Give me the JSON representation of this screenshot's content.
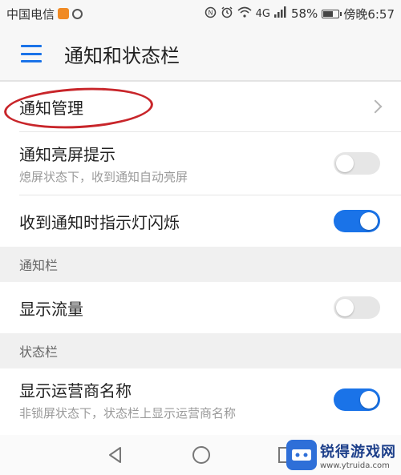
{
  "status_bar": {
    "carrier": "中国电信",
    "signal_label": "4G",
    "battery_percent": "58%",
    "time": "傍晚6:57",
    "icons": [
      "app-notification-icon",
      "circle-app-icon",
      "nfc-icon",
      "alarm-icon",
      "wifi-icon",
      "signal-icon",
      "battery-icon"
    ]
  },
  "app_bar": {
    "title": "通知和状态栏",
    "menu_icon": "menu-icon"
  },
  "settings": {
    "notification_management": {
      "title": "通知管理"
    },
    "notification_wake_screen": {
      "title": "通知亮屏提示",
      "subtitle": "熄屏状态下，收到通知自动亮屏",
      "enabled": false
    },
    "indicator_light": {
      "title": "收到通知时指示灯闪烁",
      "enabled": true
    },
    "section_notification_bar": "通知栏",
    "show_traffic": {
      "title": "显示流量",
      "enabled": false
    },
    "section_status_bar": "状态栏",
    "show_carrier_name": {
      "title": "显示运营商名称",
      "subtitle": "非锁屏状态下，状态栏上显示运营商名称",
      "enabled": true
    }
  },
  "nav_bar": {
    "icons": [
      "back-icon",
      "home-icon",
      "recent-apps-icon"
    ]
  },
  "watermark": {
    "title": "锐得游戏网",
    "url": "www.ytruida.com"
  },
  "colors": {
    "accent": "#1a73e8",
    "annotation": "#c8252a",
    "toggle_off": "#e6e6e6"
  }
}
